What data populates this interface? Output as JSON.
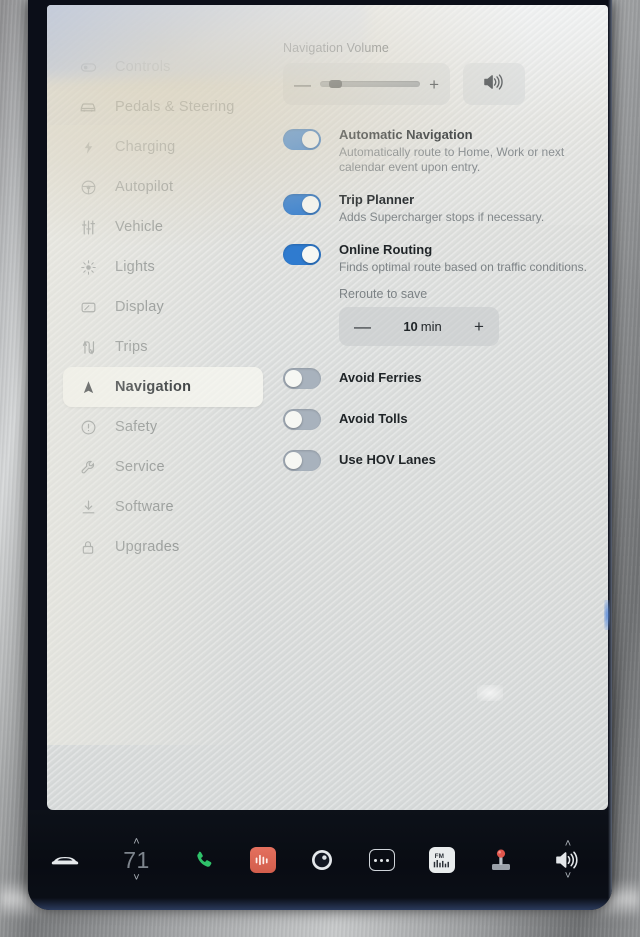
{
  "sidebar": {
    "items": [
      {
        "label": "Controls",
        "icon": "toggle-icon",
        "active": false
      },
      {
        "label": "Pedals & Steering",
        "icon": "car-icon",
        "active": false
      },
      {
        "label": "Charging",
        "icon": "bolt-icon",
        "active": false
      },
      {
        "label": "Autopilot",
        "icon": "steering-wheel-icon",
        "active": false
      },
      {
        "label": "Vehicle",
        "icon": "sliders-icon",
        "active": false
      },
      {
        "label": "Lights",
        "icon": "sun-icon",
        "active": false
      },
      {
        "label": "Display",
        "icon": "display-icon",
        "active": false
      },
      {
        "label": "Trips",
        "icon": "trips-icon",
        "active": false
      },
      {
        "label": "Navigation",
        "icon": "navigation-arrow-icon",
        "active": true
      },
      {
        "label": "Safety",
        "icon": "alert-circle-icon",
        "active": false
      },
      {
        "label": "Service",
        "icon": "wrench-icon",
        "active": false
      },
      {
        "label": "Software",
        "icon": "download-icon",
        "active": false
      },
      {
        "label": "Upgrades",
        "icon": "lock-icon",
        "active": false
      }
    ]
  },
  "volume": {
    "title": "Navigation Volume",
    "minus_label": "—",
    "plus_label": "+",
    "level_percent": 9,
    "speaker_icon": "speaker-waves-icon"
  },
  "settings": [
    {
      "label": "Automatic Navigation",
      "description": "Automatically route to Home, Work or next calendar event upon entry.",
      "state": "on"
    },
    {
      "label": "Trip Planner",
      "description": "Adds Supercharger stops if necessary.",
      "state": "on"
    },
    {
      "label": "Online Routing",
      "description": "Finds optimal route based on traffic conditions.",
      "state": "on"
    }
  ],
  "reroute": {
    "label": "Reroute to save",
    "minus_label": "—",
    "plus_label": "+",
    "value": "10",
    "unit": "min"
  },
  "options": [
    {
      "label": "Avoid Ferries",
      "state": "off"
    },
    {
      "label": "Avoid Tolls",
      "state": "off"
    },
    {
      "label": "Use HOV Lanes",
      "state": "off"
    }
  ],
  "taskbar": {
    "car_icon": "car-front-icon",
    "climate": {
      "up_chevron": "˄",
      "temperature": "71",
      "down_chevron": "˅"
    },
    "apps": [
      {
        "name": "phone-icon",
        "label": ""
      },
      {
        "name": "music-icon",
        "label": ""
      },
      {
        "name": "dashcam-icon",
        "label": ""
      },
      {
        "name": "more-icon",
        "label": ""
      },
      {
        "name": "fm-radio-icon",
        "label": "FM"
      },
      {
        "name": "arcade-icon",
        "label": ""
      }
    ],
    "volume": {
      "up_chevron": "˄",
      "speaker_icon": "speaker-waves-icon",
      "down_chevron": "˅"
    }
  },
  "colors": {
    "toggle_on": "#2f7bcf",
    "toggle_off": "#a8b2bd",
    "panel_bg": "#e3e3df",
    "taskbar_bg": "#0b0f18",
    "music_tile": "#d35e4c",
    "phone_green": "#2fc26a"
  }
}
